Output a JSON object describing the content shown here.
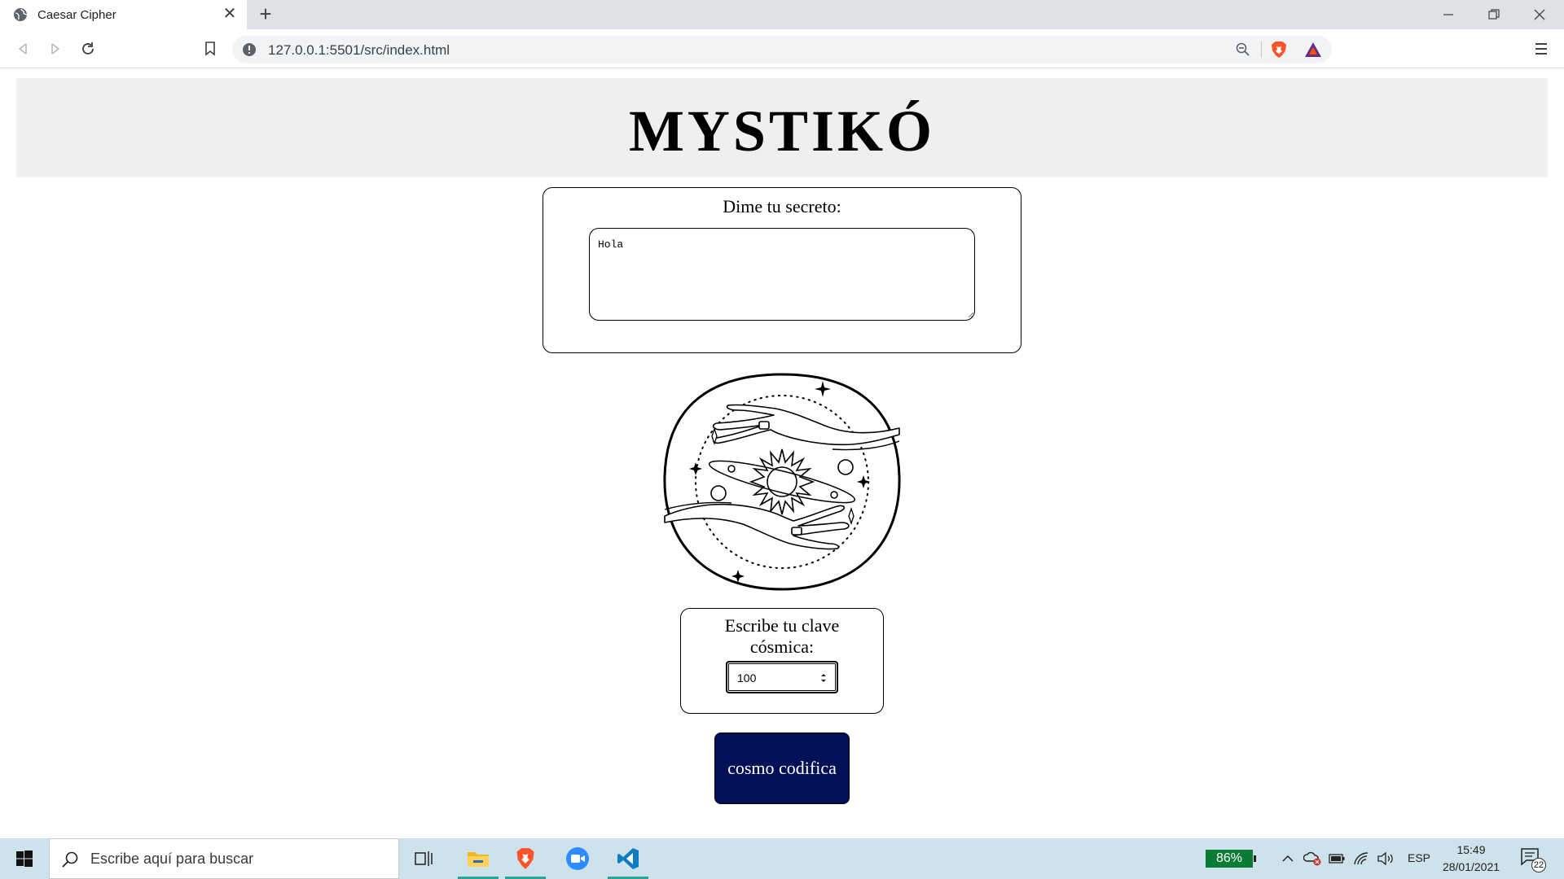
{
  "browser": {
    "tab_title": "Caesar Cipher",
    "tab_close": "✕",
    "new_tab": "+",
    "url": "127.0.0.1:5501/src/index.html"
  },
  "app": {
    "title": "MYSTIKÓ",
    "secret_label": "Dime tu secreto:",
    "secret_value": "Hola",
    "key_label": "Escribe tu clave cósmica:",
    "key_value": "100",
    "submit_label": "cosmo codifica",
    "colors": {
      "header_bg": "#efefef",
      "button_bg": "#021058",
      "button_text": "#ffffff"
    }
  },
  "taskbar": {
    "search_placeholder": "Escribe aquí para buscar",
    "battery_percent": "86%",
    "language": "ESP",
    "time": "15:49",
    "date": "28/01/2021",
    "notification_count": "22",
    "apps": [
      "task-view-icon",
      "file-explorer-icon",
      "brave-browser-icon",
      "zoom-icon",
      "vscode-icon"
    ]
  }
}
